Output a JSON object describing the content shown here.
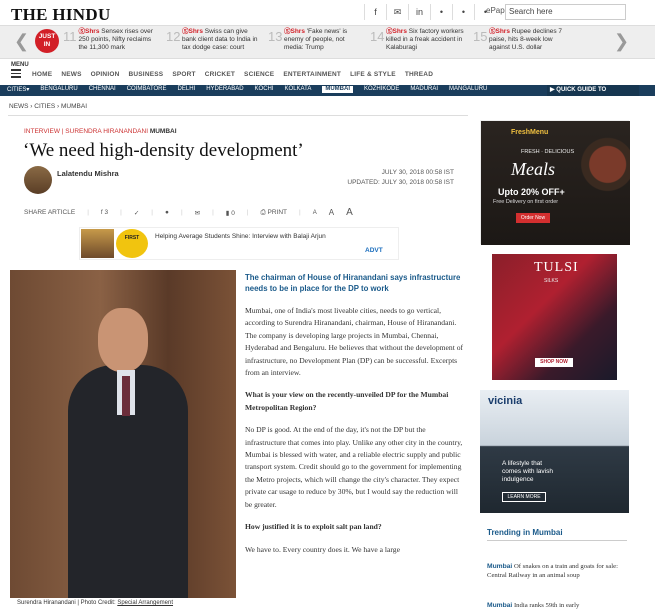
{
  "header": {
    "logo": "THE HINDU",
    "social": [
      "f",
      "✉",
      "in",
      "•",
      "•",
      "•"
    ],
    "epaper": "ePaper",
    "search_placeholder": "Search here"
  },
  "ticker": {
    "just_in": "JUST IN",
    "items": [
      {
        "num": "11",
        "tag": "ⓈShrs",
        "text": "Sensex rises over 250 points, Nifty reclaims the 11,300 mark"
      },
      {
        "num": "12",
        "tag": "ⓈShrs",
        "text": "Swiss can give bank client data to India in tax dodge case: court"
      },
      {
        "num": "13",
        "tag": "ⓈShrs",
        "text": "'Fake news' is enemy of people, not media: Trump"
      },
      {
        "num": "14",
        "tag": "ⓈShrs",
        "text": "Six factory workers killed in a freak accident in Kalaburagi"
      },
      {
        "num": "15",
        "tag": "ⓈShrs",
        "text": "Rupee declines 7 paise, hits 8-week low against U.S. dollar"
      }
    ]
  },
  "nav": {
    "menu_label": "MENU",
    "items": [
      "HOME",
      "NEWS",
      "OPINION",
      "BUSINESS",
      "SPORT",
      "CRICKET",
      "SCIENCE",
      "ENTERTAINMENT",
      "LIFE & STYLE",
      "THREAD"
    ]
  },
  "citybar": {
    "label": "CITIES▾",
    "items": [
      "BENGALURU",
      "CHENNAI",
      "COIMBATORE",
      "DELHI",
      "HYDERABAD",
      "KOCHI",
      "KOLKATA",
      "MUMBAI",
      "KOZHIKODE",
      "MADURAI",
      "MANGALURU"
    ],
    "active": "MUMBAI",
    "quick_guide": "▶ QUICK GUIDE TO"
  },
  "breadcrumb": "NEWS › CITIES › MUMBAI",
  "article": {
    "kicker": "INTERVIEW | SURENDRA HIRANANDANI",
    "kicker_section": "MUMBAI",
    "title": "‘We need high-density development’",
    "author": "Lalatendu Mishra",
    "published": "JULY 30, 2018 00:58 IST",
    "updated": "UPDATED: JULY 30, 2018 00:58 IST",
    "share_label": "SHARE ARTICLE",
    "share_count": "3",
    "comments": "0",
    "print": "PRINT",
    "caption": "Surendra Hiranandani",
    "credit_label": "| Photo Credit:",
    "credit": "Special Arrangement",
    "lead": "The chairman of House of Hiranandani says infrastructure needs to be in place for the DP to work",
    "p1": "Mumbai, one of India's most liveable cities, needs to go vertical, according to Surendra Hiranandani, chairman, House of Hiranandani. The company is developing large projects in Mumbai, Chennai, Hyderabad and Bengaluru. He believes that without the development of infrastructure, no Development Plan (DP) can be successful. Excerpts from an interview.",
    "q1": "What is your view on the recently-unveiled DP for the Mumbai Metropolitan Region?",
    "p2": "No DP is good. At the end of the day, it's not the DP but the infrastructure that comes into play. Unlike any other city in the country, Mumbai is blessed with water, and a reliable electric supply and public transport system. Credit should go to the government for implementing the Metro projects, which will change the city's character. They expect private car usage to reduce by 30%, but I would say the reduction will be greater.",
    "q2": "How justified it is to exploit salt pan land?",
    "p3": "We have to. Every country does it. We have a large"
  },
  "ad_strip": {
    "badge": "FIRST",
    "text": "Helping Average Students Shine: Interview with Balaji Arjun",
    "advt": "ADVT"
  },
  "ads": {
    "freshmenu": {
      "brand": "FreshMenu",
      "fresh": "FRESH · DELICIOUS",
      "meals": "Meals",
      "offer": "Upto 20% OFF+",
      "delivery": "Free Delivery on first order",
      "button": "Order Now"
    },
    "tulsi": {
      "name": "TULSI",
      "sub": "SILKS",
      "button": "SHOP NOW"
    },
    "vicinia": {
      "name": "vicinia",
      "tagline": "A lifestyle that comes with lavish indulgence",
      "button": "LEARN MORE"
    }
  },
  "trending": {
    "title": "Trending in Mumbai",
    "items": [
      {
        "tag": "Mumbai",
        "text": "Of snakes on a train and goats for sale: Central Railway in an animal soup"
      },
      {
        "tag": "Mumbai",
        "text": "India ranks 59th in early"
      }
    ]
  }
}
